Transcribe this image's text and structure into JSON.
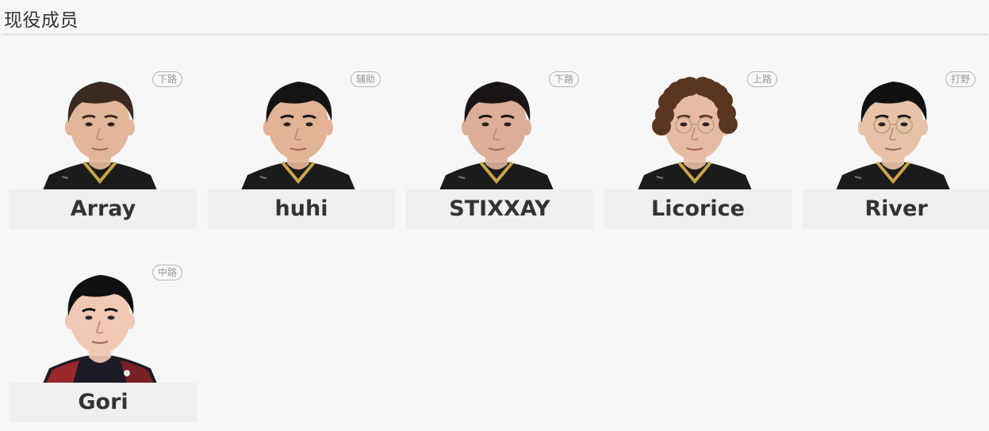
{
  "section": {
    "title": "现役成员"
  },
  "players": [
    {
      "name": "Array",
      "role": "下路",
      "hair": "#3a2a20",
      "skin": "#e4b699",
      "jersey": "dark",
      "curly": false,
      "glasses": false
    },
    {
      "name": "huhi",
      "role": "辅助",
      "hair": "#141414",
      "skin": "#e2b395",
      "jersey": "dark",
      "curly": false,
      "glasses": false
    },
    {
      "name": "STIXXAY",
      "role": "下路",
      "hair": "#1a1414",
      "skin": "#dcae98",
      "jersey": "dark",
      "curly": false,
      "glasses": false
    },
    {
      "name": "Licorice",
      "role": "上路",
      "hair": "#5a3520",
      "skin": "#e7bba3",
      "jersey": "dark",
      "curly": true,
      "glasses": true
    },
    {
      "name": "River",
      "role": "打野",
      "hair": "#111111",
      "skin": "#e8c2a6",
      "jersey": "dark",
      "curly": false,
      "glasses": true
    },
    {
      "name": "Gori",
      "role": "中路",
      "hair": "#101010",
      "skin": "#f0c8b3",
      "jersey": "red",
      "curly": false,
      "glasses": false
    }
  ]
}
